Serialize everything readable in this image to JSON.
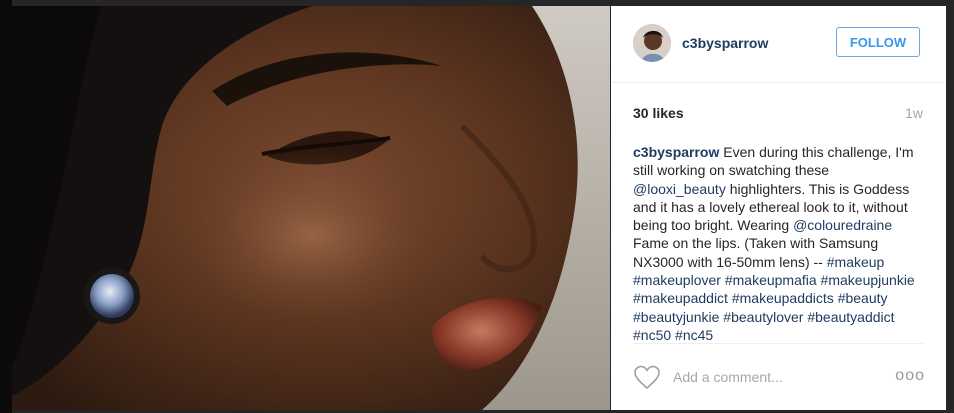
{
  "post": {
    "image_alt": "Close-up photo of a woman's face wearing highlighter and bronze lipstick"
  },
  "header": {
    "username": "c3bysparrow",
    "follow_label": "FOLLOW"
  },
  "stats": {
    "likes": "30 likes",
    "time": "1w"
  },
  "caption": {
    "username": "c3bysparrow",
    "segments": [
      {
        "text": " Even during this challenge, I'm still working on swatching these ",
        "link": false
      },
      {
        "text": "@looxi_beauty",
        "link": true
      },
      {
        "text": " highlighters. This is Goddess and it has a lovely ethereal look to it, without being too bright. Wearing ",
        "link": false
      },
      {
        "text": "@colouredraine",
        "link": true
      },
      {
        "text": " Fame on the lips. (Taken with Samsung NX3000 with 16-50mm lens) -- ",
        "link": false
      },
      {
        "text": "#makeup",
        "link": true
      },
      {
        "text": " ",
        "link": false
      },
      {
        "text": "#makeuplover",
        "link": true
      },
      {
        "text": " ",
        "link": false
      },
      {
        "text": "#makeupmafia",
        "link": true
      },
      {
        "text": " ",
        "link": false
      },
      {
        "text": "#makeupjunkie",
        "link": true
      },
      {
        "text": " ",
        "link": false
      },
      {
        "text": "#makeupaddict",
        "link": true
      },
      {
        "text": " ",
        "link": false
      },
      {
        "text": "#makeupaddicts",
        "link": true
      },
      {
        "text": " ",
        "link": false
      },
      {
        "text": "#beauty",
        "link": true
      },
      {
        "text": " ",
        "link": false
      },
      {
        "text": "#beautyjunkie",
        "link": true
      },
      {
        "text": " ",
        "link": false
      },
      {
        "text": "#beautylover",
        "link": true
      },
      {
        "text": " ",
        "link": false
      },
      {
        "text": "#beautyaddict",
        "link": true
      },
      {
        "text": " ",
        "link": false
      },
      {
        "text": "#nc50",
        "link": true
      },
      {
        "text": " ",
        "link": false
      },
      {
        "text": "#nc45",
        "link": true
      }
    ]
  },
  "comment": {
    "placeholder": "Add a comment...",
    "more_label": "ooo"
  },
  "icons": {
    "like": "heart-outline-icon",
    "more": "more-options-icon"
  },
  "colors": {
    "link": "#1d3a5f",
    "follow": "#3897f0",
    "muted": "#a5a7aa"
  }
}
